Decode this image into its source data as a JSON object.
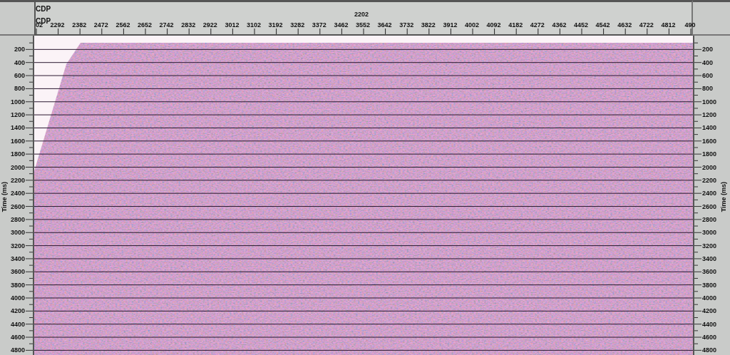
{
  "cdp_axis": {
    "titles": [
      "CDP",
      "CDP"
    ],
    "center_label": "2202",
    "ticks": [
      "02",
      "2292",
      "2382",
      "2472",
      "2562",
      "2652",
      "2742",
      "2832",
      "2922",
      "3012",
      "3102",
      "3192",
      "3282",
      "3372",
      "3462",
      "3552",
      "3642",
      "3732",
      "3822",
      "3912",
      "4002",
      "4092",
      "4182",
      "4272",
      "4362",
      "4452",
      "4542",
      "4632",
      "4722",
      "4812",
      "490"
    ]
  },
  "left_time_axis": {
    "title": "Time (ms)",
    "ticks": [
      "200",
      "400",
      "600",
      "800",
      "1000",
      "1200",
      "1400",
      "1600",
      "1800",
      "2000",
      "2200",
      "2400",
      "2600",
      "2800",
      "3000",
      "3200",
      "3400",
      "3600",
      "3800",
      "4000",
      "4200",
      "4400",
      "4600",
      "4800"
    ]
  },
  "right_time_axis": {
    "title": "Time (ms)",
    "ticks": [
      "200",
      "400",
      "600",
      "800",
      "1000",
      "1200",
      "1400",
      "1600",
      "1800",
      "2000",
      "2200",
      "2400",
      "2600",
      "2800",
      "3000",
      "3200",
      "3400",
      "3600",
      "3800",
      "4000",
      "4200",
      "4400",
      "4600",
      "4800"
    ]
  }
}
